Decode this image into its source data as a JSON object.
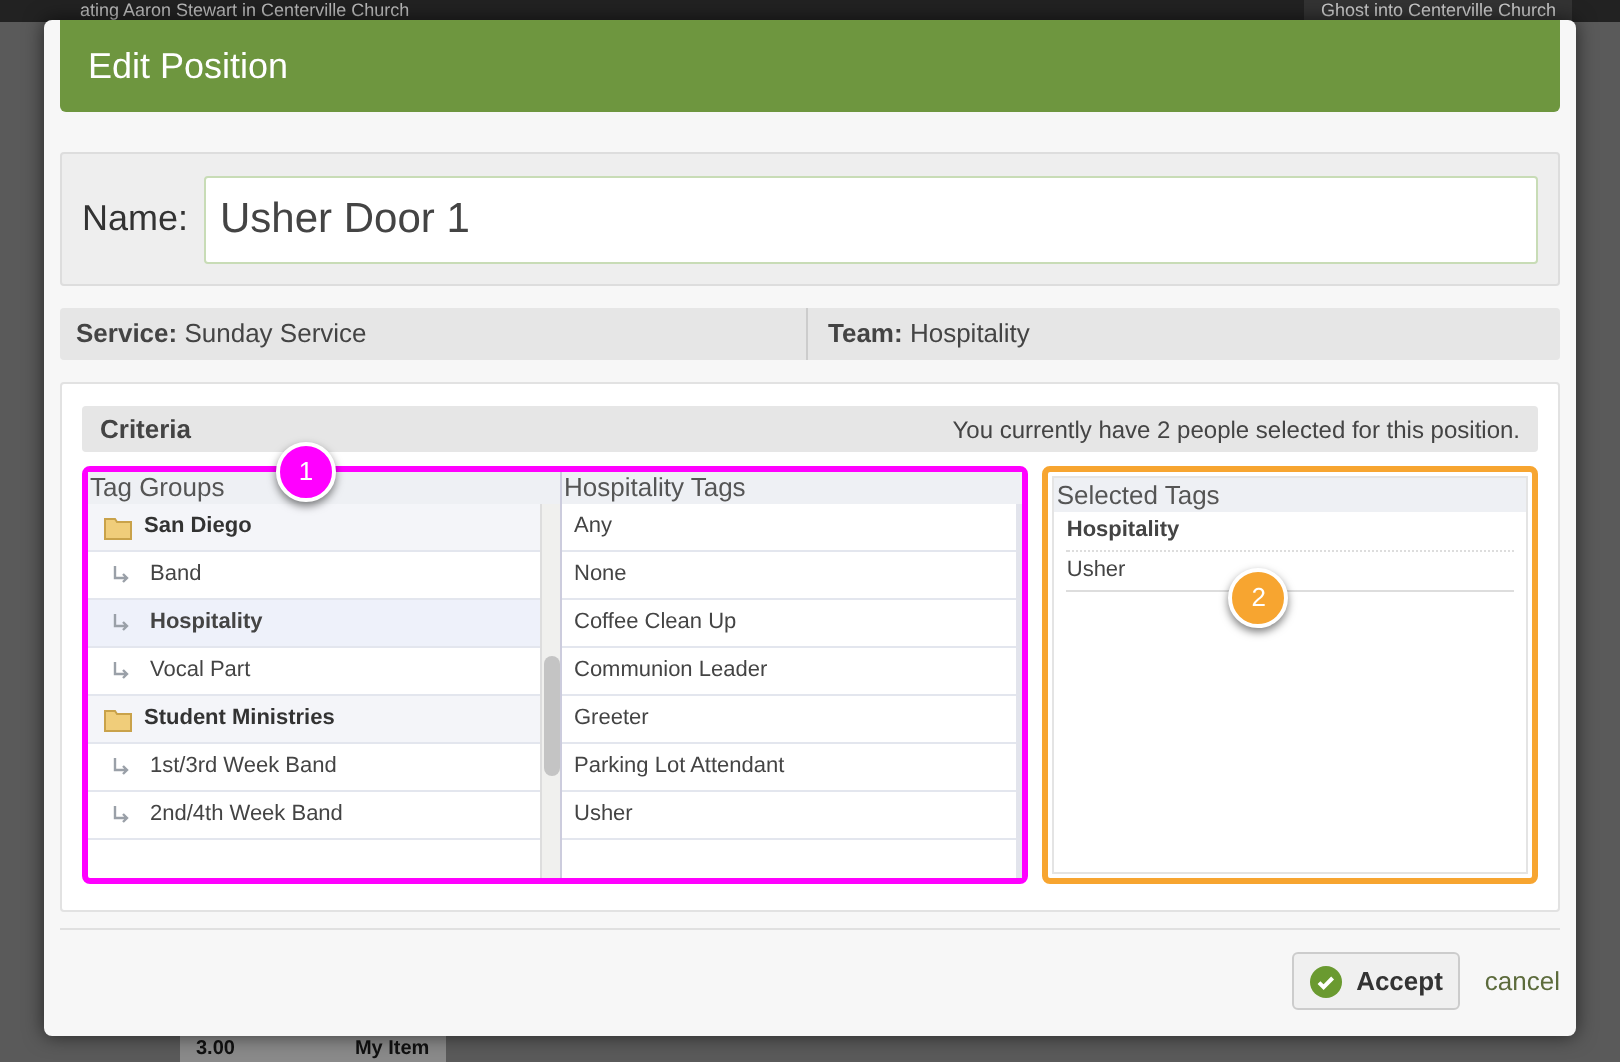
{
  "background": {
    "top_left": "ating Aaron Stewart in Centerville Church",
    "top_right": "Ghost into Centerville Church",
    "bottom_time": "3.00",
    "bottom_item": "My Item"
  },
  "dialog": {
    "title": "Edit Position",
    "name": {
      "label": "Name:",
      "value": "Usher Door 1"
    },
    "service": {
      "label": "Service:",
      "value": "Sunday Service"
    },
    "team": {
      "label": "Team:",
      "value": "Hospitality"
    },
    "criteria": {
      "title": "Criteria",
      "summary": "You currently have 2 people selected for this position.",
      "tag_groups": {
        "heading": "Tag Groups",
        "items": [
          {
            "label": "San Diego",
            "selected": false,
            "children": [
              {
                "label": "Band",
                "selected": false
              },
              {
                "label": "Hospitality",
                "selected": true
              },
              {
                "label": "Vocal Part",
                "selected": false
              }
            ]
          },
          {
            "label": "Student Ministries",
            "selected": false,
            "children": [
              {
                "label": "1st/3rd Week Band",
                "selected": false
              },
              {
                "label": "2nd/4th Week Band",
                "selected": false
              }
            ]
          }
        ]
      },
      "group_tags": {
        "heading": "Hospitality Tags",
        "items": [
          "Any",
          "None",
          "Coffee Clean Up",
          "Communion Leader",
          "Greeter",
          "Parking Lot Attendant",
          "Usher"
        ]
      },
      "selected_tags": {
        "heading": "Selected Tags",
        "groups": [
          {
            "label": "Hospitality",
            "tags": [
              "Usher"
            ]
          }
        ]
      }
    },
    "buttons": {
      "accept": "Accept",
      "cancel": "cancel"
    }
  },
  "annotations": [
    {
      "label": "1",
      "color": "#ff00ff"
    },
    {
      "label": "2",
      "color": "#f7a530"
    }
  ]
}
